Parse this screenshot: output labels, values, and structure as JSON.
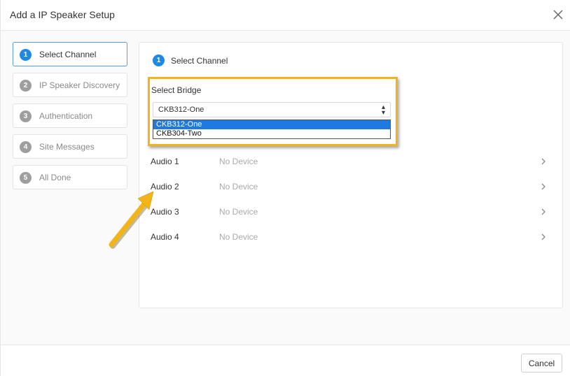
{
  "dialog": {
    "title": "Add a IP Speaker Setup",
    "close_icon": "close-icon"
  },
  "steps": [
    {
      "num": "1",
      "label": "Select Channel",
      "active": true
    },
    {
      "num": "2",
      "label": "IP Speaker Discovery",
      "active": false
    },
    {
      "num": "3",
      "label": "Authentication",
      "active": false
    },
    {
      "num": "4",
      "label": "Site Messages",
      "active": false
    },
    {
      "num": "5",
      "label": "All Done",
      "active": false
    }
  ],
  "panel": {
    "step_num": "1",
    "title": "Select Channel",
    "bridge_label": "Select Bridge",
    "select_value": "CKB312-One",
    "options": [
      "CKB312-One",
      "CKB304-Two"
    ],
    "audio": [
      {
        "name": "Audio 1",
        "device": "No Device"
      },
      {
        "name": "Audio 2",
        "device": "No Device"
      },
      {
        "name": "Audio 3",
        "device": "No Device"
      },
      {
        "name": "Audio 4",
        "device": "No Device"
      }
    ]
  },
  "footer": {
    "cancel_label": "Cancel"
  },
  "colors": {
    "accent": "#1e88e5",
    "highlight": "#f2b416"
  }
}
